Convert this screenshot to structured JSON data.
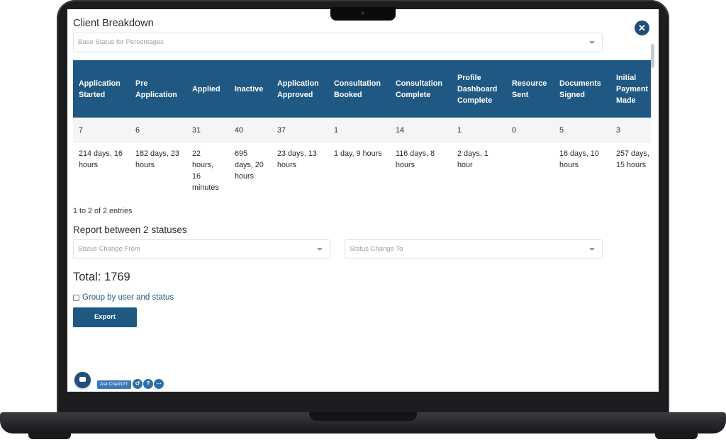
{
  "modal": {
    "title": "Client Breakdown",
    "close_icon": "close-icon"
  },
  "base_status": {
    "placeholder": "Base Status for Percentages"
  },
  "table": {
    "columns": [
      "Application Started",
      "Pre Application",
      "Applied",
      "Inactive",
      "Application Approved",
      "Consultation Booked",
      "Consultation Complete",
      "Profile Dashboard Complete",
      "Resource Sent",
      "Documents Signed",
      "Initial Payment Made"
    ],
    "rows": [
      [
        "7",
        "6",
        "31",
        "40",
        "37",
        "1",
        "14",
        "1",
        "0",
        "5",
        "3"
      ],
      [
        "214 days, 16 hours",
        "182 days, 23 hours",
        "22 hours, 16 minutes",
        "695 days, 20 hours",
        "23 days, 13 hours",
        "1 day, 9 hours",
        "116 days, 8 hours",
        "2 days, 1 hour",
        "",
        "16 days, 10 hours",
        "257 days, 15 hours"
      ]
    ]
  },
  "entries_info": "1 to 2 of 2 entries",
  "report": {
    "title": "Report between 2 statuses",
    "from_placeholder": "Status Change From",
    "to_placeholder": "Status Change To"
  },
  "total": "Total: 1769",
  "group_by_label": "Group by user and status",
  "export_label": "Export",
  "widgets": {
    "ask_label": "Ask ChatGPT",
    "icons": [
      "chat-icon",
      "history-icon",
      "help-icon",
      "more-icon"
    ]
  },
  "colors": {
    "header_bg": "#1f5883",
    "button_bg": "#1f5883",
    "close_bg": "#1f4f7a",
    "link": "#1f5883"
  }
}
